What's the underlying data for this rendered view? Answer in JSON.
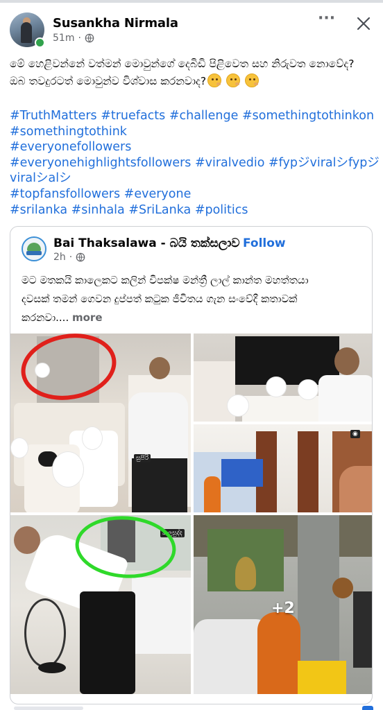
{
  "post": {
    "author": "Susankha Nirmala",
    "time": "51m",
    "time_sep": "·",
    "privacy_icon": "globe-icon",
    "text_lines": [
      "මේ හෙළිවන්නේ වත්මන් මොවුන්ගේ දෙබිඩි පිළිවෙත  සහ නිරුවත නොවේද?",
      "ඔබ තවදුරටත් මොවුන්ව විශ්වාස කරනවාද?"
    ],
    "emoji": [
      "thinking-face-emoji",
      "thinking-face-emoji",
      "thinking-face-emoji"
    ],
    "hashtag_lines": [
      "#TruthMatters #truefacts #challenge #somethingtothinkon",
      "#somethingtothink",
      "#everyonefollowers",
      "#everyonehighlightsfollowers #viralvedio #fypジviralシfypジ",
      "viralシalシ",
      "#topfansfollowers #everyone",
      "#srilanka #sinhala #SriLanka #politics"
    ]
  },
  "shared": {
    "page_name": "Bai Thaksalawa - බයි තක්සලාව",
    "separator": "·",
    "follow_label": "Follow",
    "time": "2h",
    "time_sep": "·",
    "text_lines": [
      "මට මතකයි කාලෙකට කලින් විපක්ෂ මන්ත්‍රී ලාල් කාන්ත මහත්තයා",
      "දවසක් තමන් ගෙවන දුප්පත් කටුක ජීවිතය ගැන සංවේදී කතාවක්",
      "කරනවා...."
    ],
    "see_more": "more",
    "photos": {
      "more_count": "+2",
      "watermark": "සුපිරි",
      "watermark2": "කලුසුද්ද"
    }
  },
  "colors": {
    "link": "#216fdb",
    "secondary_text": "#65676b",
    "online": "#31a24c",
    "red_circle": "#e0201b",
    "green_circle": "#2fd92a"
  }
}
